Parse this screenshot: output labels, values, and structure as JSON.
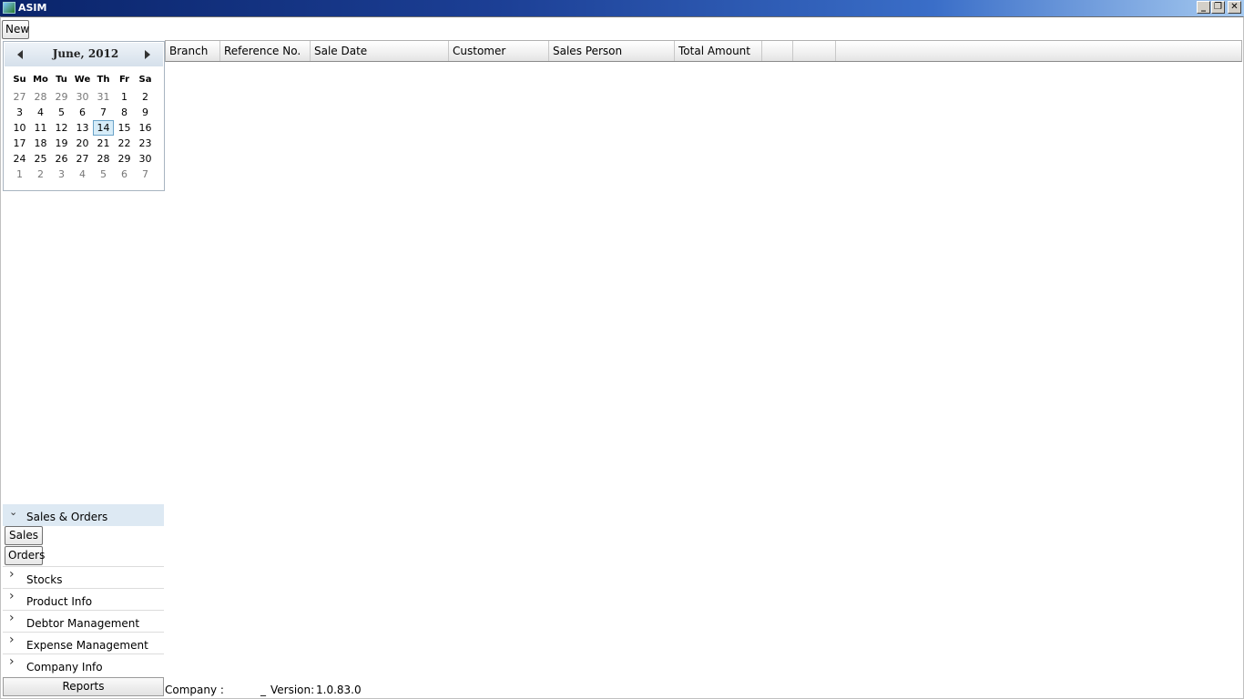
{
  "window": {
    "title": "ASIM"
  },
  "toolbar": {
    "new_label": "New"
  },
  "calendar": {
    "month_label": "June, 2012",
    "weekday_labels": [
      "Su",
      "Mo",
      "Tu",
      "We",
      "Th",
      "Fr",
      "Sa"
    ],
    "weeks": [
      [
        "27",
        "28",
        "29",
        "30",
        "31",
        "1",
        "2"
      ],
      [
        "3",
        "4",
        "5",
        "6",
        "7",
        "8",
        "9"
      ],
      [
        "10",
        "11",
        "12",
        "13",
        "14",
        "15",
        "16"
      ],
      [
        "17",
        "18",
        "19",
        "20",
        "21",
        "22",
        "23"
      ],
      [
        "24",
        "25",
        "26",
        "27",
        "28",
        "29",
        "30"
      ],
      [
        "1",
        "2",
        "3",
        "4",
        "5",
        "6",
        "7"
      ]
    ],
    "selected_day": "14"
  },
  "grid": {
    "columns": [
      "Branch",
      "Reference No.",
      "Sale Date",
      "Customer",
      "Sales Person",
      "Total Amount",
      "",
      ""
    ]
  },
  "nav": {
    "expanded_group": "Sales & Orders",
    "sales_label": "Sales",
    "orders_label": "Orders",
    "groups": [
      "Stocks",
      "Product Info",
      "Debtor Management",
      "Expense Management",
      "Company Info"
    ],
    "reports_label": "Reports"
  },
  "status": {
    "company_label": "Company :",
    "separator": "_",
    "version_label": "Version:",
    "version": "1.0.83.0"
  }
}
